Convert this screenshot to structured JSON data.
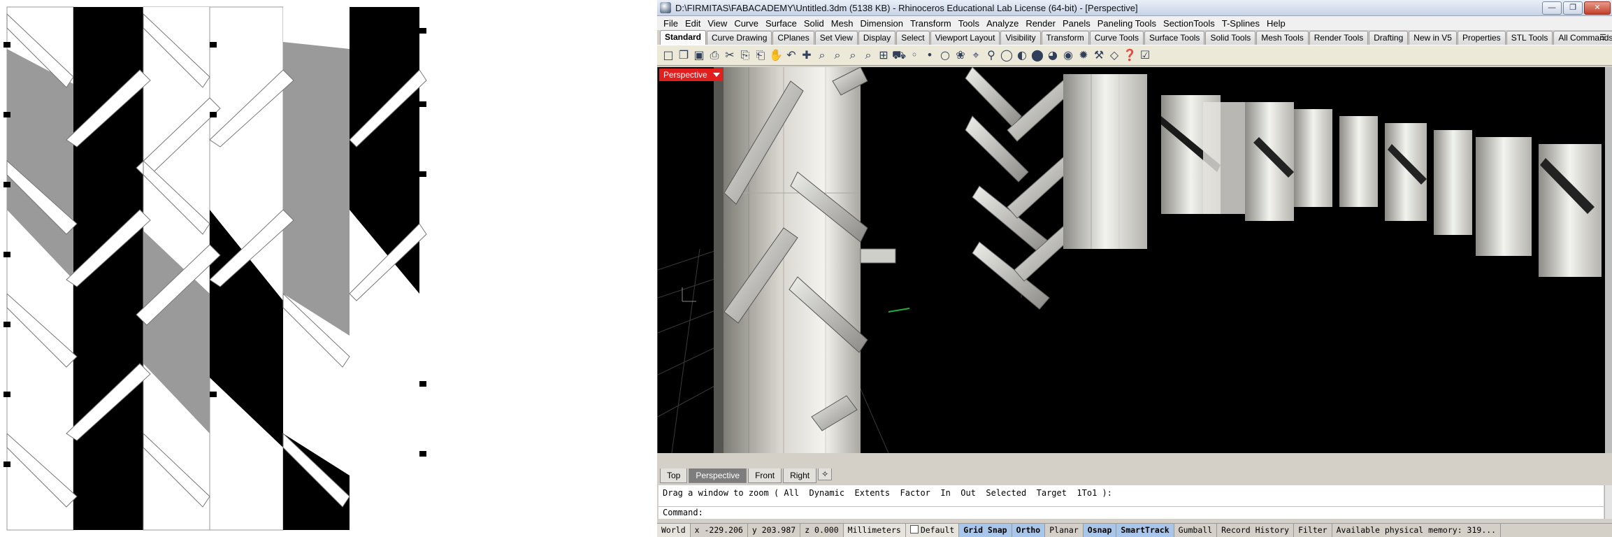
{
  "app": {
    "title": "D:\\FIRMITAS\\FABACADEMY\\Untitled.3dm (5138 KB) - Rhinoceros Educational Lab License (64-bit) - [Perspective]",
    "window_buttons": {
      "minimize": "—",
      "maximize": "❐",
      "close": "✕"
    }
  },
  "menu": [
    "File",
    "Edit",
    "View",
    "Curve",
    "Surface",
    "Solid",
    "Mesh",
    "Dimension",
    "Transform",
    "Tools",
    "Analyze",
    "Render",
    "Panels",
    "Paneling Tools",
    "SectionTools",
    "T-Splines",
    "Help"
  ],
  "toolbar_tabs": [
    "Standard",
    "Curve Drawing",
    "CPlanes",
    "Set View",
    "Display",
    "Select",
    "Viewport Layout",
    "Visibility",
    "Transform",
    "Curve Tools",
    "Surface Tools",
    "Solid Tools",
    "Mesh Tools",
    "Render Tools",
    "Drafting",
    "New in V5",
    "Properties",
    "STL Tools",
    "All Commands"
  ],
  "toolbar_tab_more": "☰",
  "toolbar_icons": [
    "□",
    "❐",
    "▣",
    "⎙",
    "✂",
    "⎘",
    "⎗",
    "✋",
    "↶",
    "✚",
    "⌕",
    "⌕",
    "⌕",
    "⌕",
    "⊞",
    "⛟",
    "◦",
    "•",
    "○",
    "❀",
    "⌖",
    "⚲",
    "◯",
    "◐",
    "⬤",
    "◕",
    "◉",
    "✹",
    "⚒",
    "◇",
    "❓",
    "☑"
  ],
  "viewport": {
    "name": "Perspective",
    "colors": {
      "background": "#000000",
      "label": "#e21f1f"
    }
  },
  "viewport_tabs": [
    "Top",
    "Perspective",
    "Front",
    "Right"
  ],
  "viewport_tab_add": "✧",
  "command": {
    "history": "Drag a window to zoom ( All  Dynamic  Extents  Factor  In  Out  Selected  Target  1To1 ):",
    "prompt": "Command:",
    "value": ""
  },
  "status": {
    "cplane": "World",
    "x": "x -229.206",
    "y": "y 203.987",
    "z": "z 0.000",
    "units": "Millimeters",
    "layer": "Default",
    "toggles": [
      {
        "label": "Grid Snap",
        "on": true
      },
      {
        "label": "Ortho",
        "on": true
      },
      {
        "label": "Planar",
        "on": false
      },
      {
        "label": "Osnap",
        "on": true
      },
      {
        "label": "SmartTrack",
        "on": true
      },
      {
        "label": "Gumball",
        "on": false
      },
      {
        "label": "Record History",
        "on": false
      },
      {
        "label": "Filter",
        "on": false
      }
    ],
    "memory": "Available physical memory: 319..."
  }
}
